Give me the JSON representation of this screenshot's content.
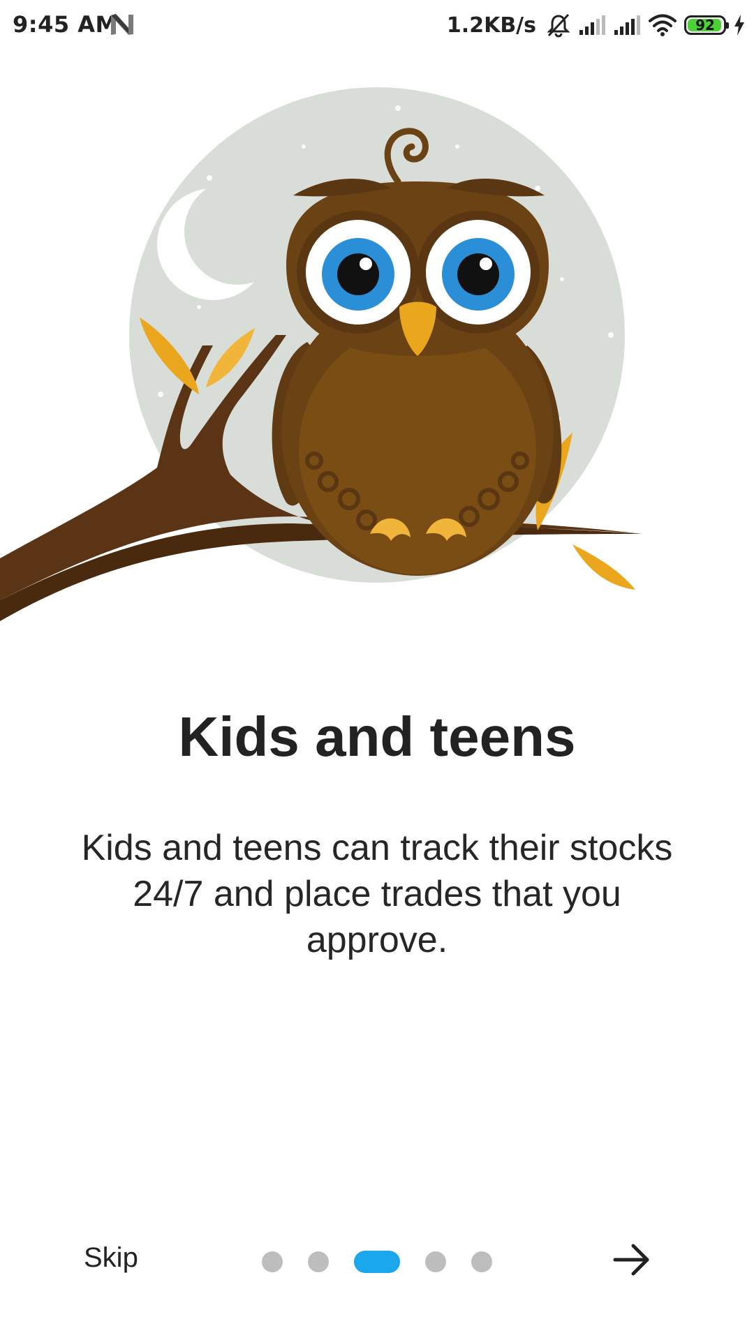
{
  "status_bar": {
    "time": "9:45 AM",
    "net_speed": "1.2KB/s",
    "battery_level": "92",
    "icons": [
      "n-notification-icon",
      "mute-bell-icon",
      "signal-icon",
      "signal-icon",
      "wifi-icon",
      "battery-icon",
      "charging-icon"
    ]
  },
  "onboarding": {
    "illustration": "owl-on-branch-moon-illustration",
    "title": "Kids and teens",
    "description": "Kids and teens can track their stocks 24/7 and place trades that you approve.",
    "page_total": 5,
    "current_page": 3
  },
  "nav": {
    "skip_label": "Skip",
    "next_icon": "arrow-right-icon"
  },
  "colors": {
    "accent": "#1aa7ec",
    "inactive_dot": "#bdbdbd",
    "text": "#222222",
    "moon_bg": "#d9ddd8",
    "owl_body": "#7a4d15",
    "owl_eye_iris": "#2a8fd6",
    "leaf": "#eaa61c"
  }
}
